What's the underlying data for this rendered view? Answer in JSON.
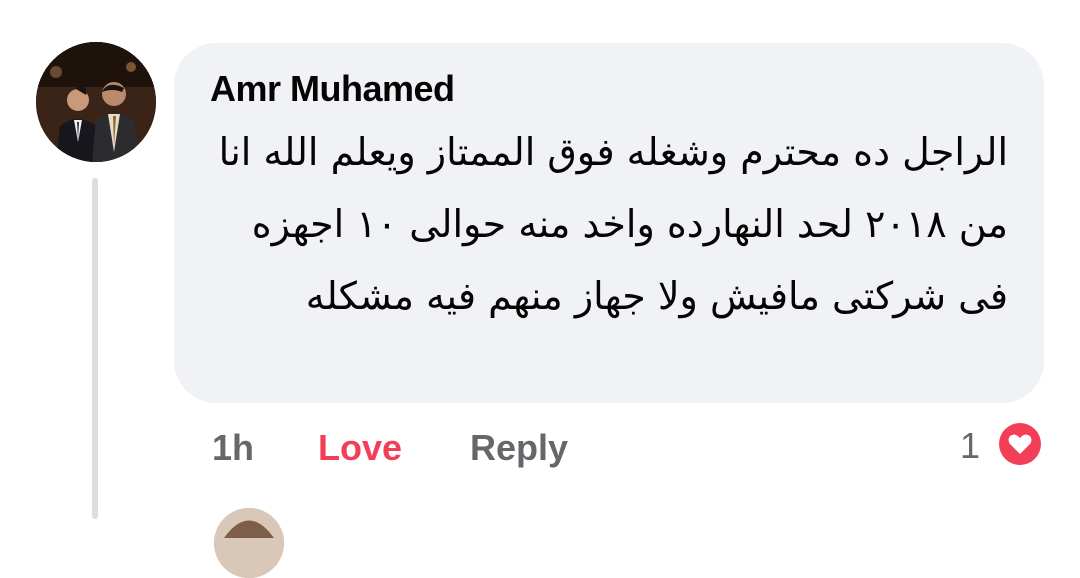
{
  "comment": {
    "author": "Amr Muhamed",
    "body": "الراجل ده محترم وشغله فوق الممتاز ويعلم الله انا من ٢٠١٨ لحد النهارده واخد منه حوالى ١٠ اجهزه فى شركتى مافيش ولا جهاز منهم فيه مشكله",
    "time": "1h",
    "love_label": "Love",
    "reply_label": "Reply",
    "reaction_count": "1",
    "reaction_icon": "heart-icon"
  },
  "colors": {
    "bubble": "#f0f2f5",
    "love": "#f33e58",
    "muted": "#65676b",
    "text": "#050505"
  }
}
